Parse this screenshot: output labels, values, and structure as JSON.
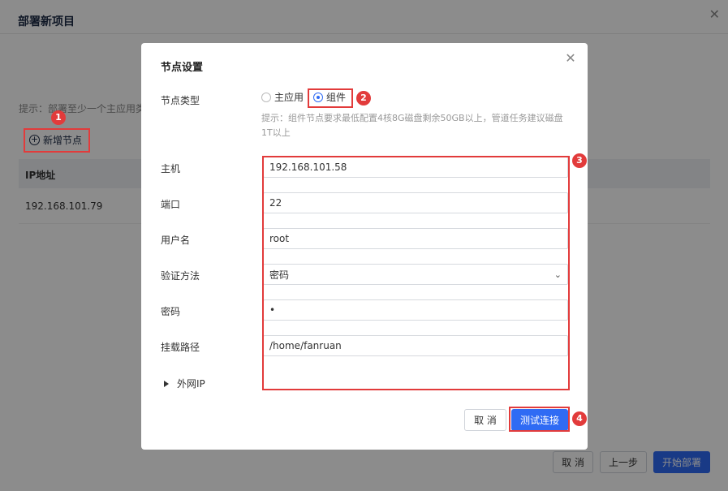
{
  "background": {
    "title": "部署新项目",
    "tip": "提示：部署至少一个主应用类",
    "add_node_label": "新增节点",
    "table": {
      "header": "IP地址",
      "rows": [
        "192.168.101.79"
      ]
    },
    "footer": {
      "cancel": "取 消",
      "prev": "上一步",
      "start": "开始部署"
    }
  },
  "modal": {
    "title": "节点设置",
    "node_type": {
      "label": "节点类型",
      "options": [
        "主应用",
        "组件"
      ],
      "selected": "组件",
      "hint": "提示：组件节点要求最低配置4核8G磁盘剩余50GB以上，管道任务建议磁盘1T以上"
    },
    "fields": {
      "host": {
        "label": "主机",
        "value": "192.168.101.58"
      },
      "port": {
        "label": "端口",
        "value": "22"
      },
      "username": {
        "label": "用户名",
        "value": "root"
      },
      "auth": {
        "label": "验证方法",
        "value": "密码"
      },
      "password": {
        "label": "密码",
        "value": "•"
      },
      "mount": {
        "label": "挂载路径",
        "value": "/home/fanruan"
      }
    },
    "external_ip_label": "外网IP",
    "cancel_label": "取 消",
    "test_label": "测试连接"
  },
  "annotations": [
    "1",
    "2",
    "3",
    "4"
  ],
  "colors": {
    "primary": "#2f6bf4",
    "annotation": "#e23b3b"
  }
}
